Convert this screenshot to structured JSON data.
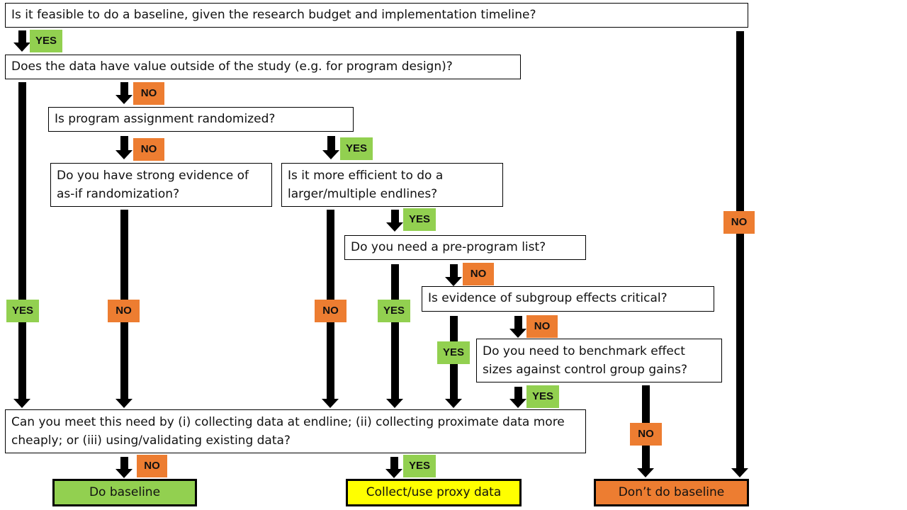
{
  "colors": {
    "yes": "#92d050",
    "no": "#ed7d31",
    "proxy": "#ffff00",
    "do_baseline": "#92d050",
    "dont_baseline": "#ed7d31"
  },
  "questions": {
    "q1": "Is it feasible to do a baseline, given the research budget and implementation timeline?",
    "q2": "Does the data have value outside of the study (e.g. for program design)?",
    "q3": "Is program assignment randomized?",
    "q4": "Do you have strong evidence of as-if randomization?",
    "q5": "Is it more efficient to do a larger/multiple endlines?",
    "q6": "Do you need a pre-program list?",
    "q7": "Is evidence of subgroup effects critical?",
    "q8": "Do you need to benchmark effect sizes against control group gains?",
    "q9": "Can you meet this need by (i) collecting data at endline; (ii) collecting proximate data more cheaply; or (iii) using/validating existing data?"
  },
  "outcomes": {
    "do_baseline": "Do baseline",
    "proxy": "Collect/use proxy data",
    "dont_baseline": "Don’t do baseline"
  },
  "labels": {
    "yes": "YES",
    "no": "NO"
  }
}
